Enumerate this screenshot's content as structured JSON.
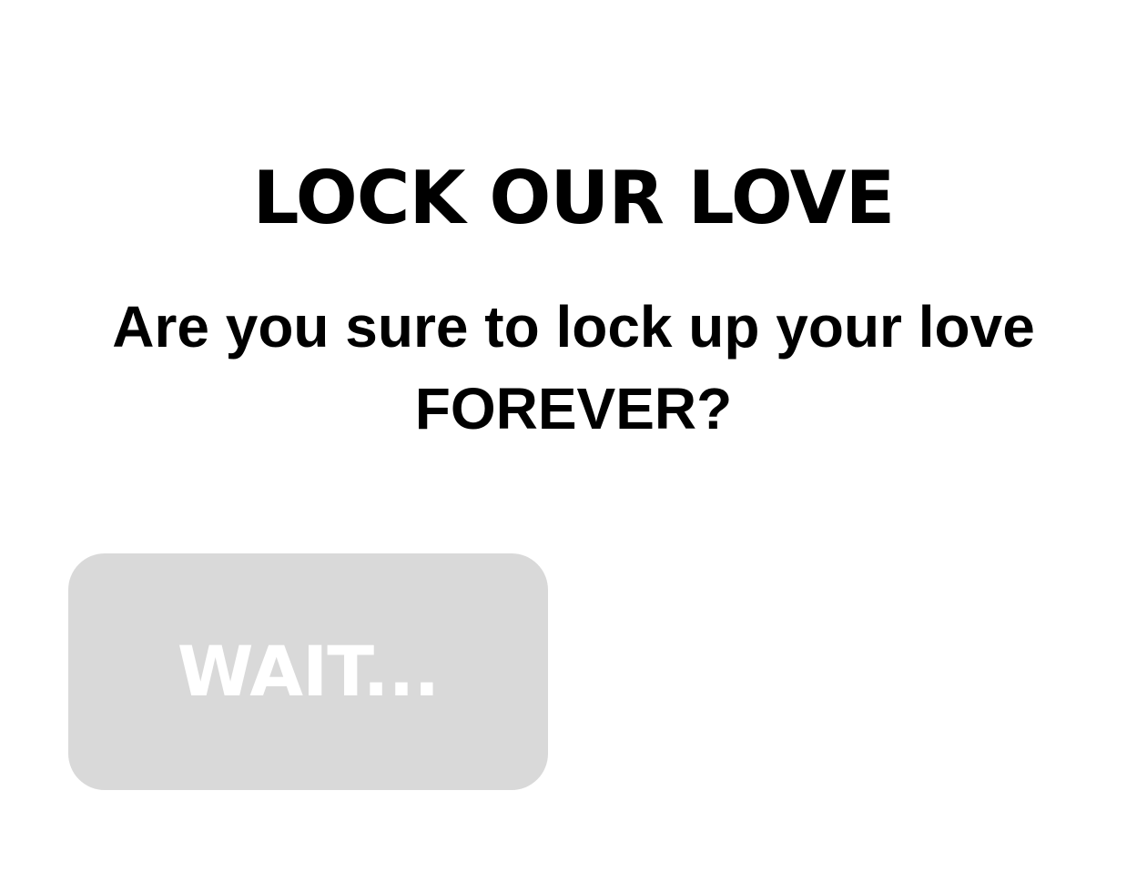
{
  "header": {
    "title": "LOCK OUR LOVE"
  },
  "prompt": {
    "question": "Are you sure to lock up your love FOREVER?"
  },
  "actions": {
    "wait_label": "WAIT..."
  },
  "colors": {
    "background": "#ffffff",
    "text": "#000000",
    "button_disabled": "#d9d9d9",
    "button_text": "#ffffff"
  }
}
